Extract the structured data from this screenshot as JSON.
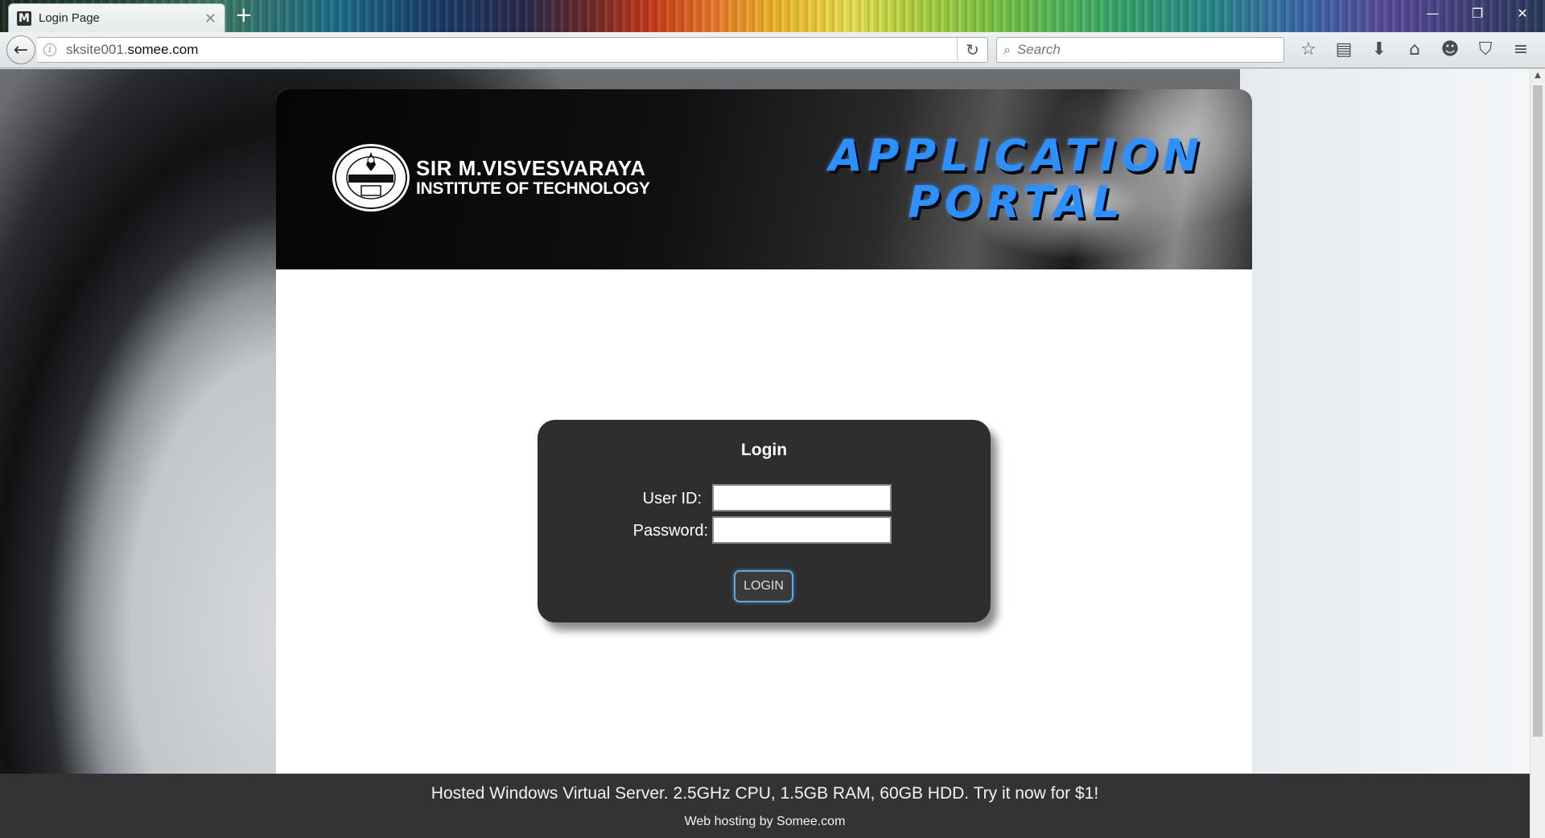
{
  "browser": {
    "tab_title": "Login Page",
    "tab_favicon": "M",
    "url_prefix": "sksite001.",
    "url_domain": "somee.com",
    "search_placeholder": "Search",
    "window_controls": [
      "minimize-icon",
      "restore-icon",
      "close-icon"
    ],
    "toolbar_icons": [
      "bookmark-star-icon",
      "reading-list-icon",
      "download-icon",
      "home-icon",
      "smiley-icon",
      "pocket-icon",
      "menu-icon"
    ]
  },
  "header": {
    "institute_line1": "SIR M.VISVESVARAYA",
    "institute_line2": "INSTITUTE OF TECHNOLOGY",
    "portal_line1": "APPLICATION",
    "portal_line2": "PORTAL"
  },
  "login": {
    "title": "Login",
    "userid_label": "User ID:",
    "userid_value": "",
    "password_label": "Password:",
    "password_value": "",
    "button_label": "LOGIN"
  },
  "footer": {
    "ad_text": "Hosted Windows Virtual Server. 2.5GHz CPU, 1.5GB RAM, 60GB HDD. Try it now for $1!",
    "host_text": "Web hosting by Somee.com"
  },
  "colors": {
    "portal_title": "#2e8fff",
    "login_box": "#2e2e2e",
    "footer": "#333333",
    "login_button_glow": "#5fa8d8"
  }
}
